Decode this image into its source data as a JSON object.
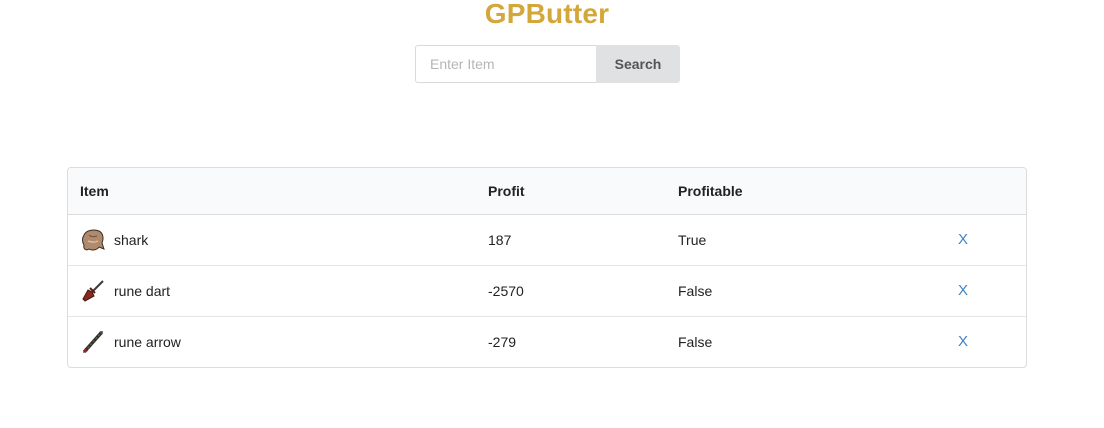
{
  "app": {
    "title": "GPButter"
  },
  "search": {
    "placeholder": "Enter Item",
    "value": "",
    "button_label": "Search"
  },
  "table": {
    "headers": {
      "item": "Item",
      "profit": "Profit",
      "profitable": "Profitable"
    },
    "rows": [
      {
        "icon": "shark-icon",
        "name": "shark",
        "profit": "187",
        "profitable": "True",
        "remove": "X"
      },
      {
        "icon": "rune-dart-icon",
        "name": "rune dart",
        "profit": "-2570",
        "profitable": "False",
        "remove": "X"
      },
      {
        "icon": "rune-arrow-icon",
        "name": "rune arrow",
        "profit": "-279",
        "profitable": "False",
        "remove": "X"
      }
    ]
  },
  "colors": {
    "brand": "#d4a73a",
    "link": "#4183c4",
    "button_bg": "#e0e1e2"
  }
}
